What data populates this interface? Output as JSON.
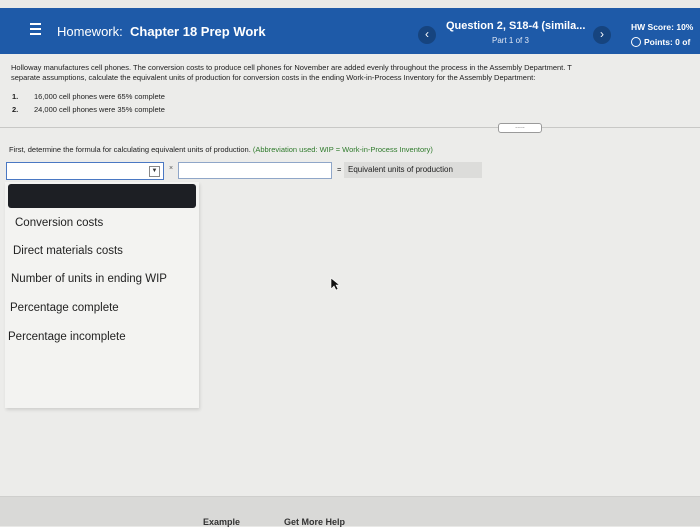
{
  "header": {
    "menu_icon": "hamburger-menu-icon",
    "title_prefix": "Homework:",
    "title": "Chapter 18 Prep Work",
    "question_title": "Question 2, S18-4 (simila...",
    "question_part": "Part 1 of 3",
    "prev_icon": "chevron-left-icon",
    "prev_glyph": "‹",
    "next_icon": "chevron-right-icon",
    "next_glyph": "›",
    "hw_score": "HW Score: 10%",
    "points": "Points: 0 of"
  },
  "problem": {
    "text": "Holloway manufactures cell phones. The conversion costs to produce cell phones for November are added evenly throughout the process in the Assembly Department. T\nseparate assumptions, calculate the equivalent units of production for conversion costs in the ending Work-in-Process Inventory for the Assembly Department:",
    "items": [
      {
        "num": "1.",
        "text": "16,000 cell phones were 65% complete"
      },
      {
        "num": "2.",
        "text": "24,000 cell phones were 35% complete"
      }
    ],
    "more_button": "....."
  },
  "question": {
    "instruction": "First, determine the formula for calculating equivalent units of production.",
    "abbreviation": "(Abbreviation used: WIP = Work-in-Process Inventory)",
    "dropdown_arrow": "▼",
    "times_symbol": "×",
    "equals_symbol": "=",
    "result_label": "Equivalent units of production"
  },
  "dropdown": {
    "selected_value": "",
    "options": [
      "Conversion costs",
      "Direct materials costs",
      "Number of units in ending WIP",
      "Percentage complete",
      "Percentage incomplete"
    ]
  },
  "footer": {
    "example_link": "Example",
    "help_link": "Get More Help"
  },
  "colors": {
    "header_bg": "#1e5aa8",
    "abbreviation_green": "#2e7a2b",
    "dropdown_selected_bg": "#1d1f24"
  }
}
